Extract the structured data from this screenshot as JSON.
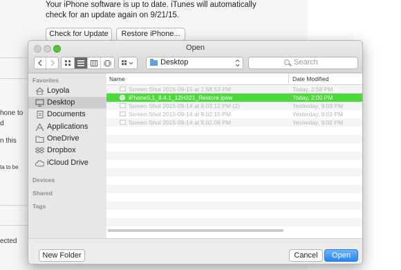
{
  "background": {
    "status_line1": "Your iPhone software is up to date. iTunes will automatically",
    "status_line2": "check for an update again on 9/21/15.",
    "check_update_label": "Check for Update",
    "restore_label": "Restore iPhone...",
    "side_text": [
      "hone to",
      "d",
      "n this",
      "ta to be",
      "ected"
    ]
  },
  "dialog": {
    "title": "Open",
    "location": "Desktop",
    "search_placeholder": "Search",
    "sidebar": {
      "favorites_header": "Favorites",
      "devices_header": "Devices",
      "shared_header": "Shared",
      "tags_header": "Tags",
      "items": [
        {
          "label": "Loyola",
          "icon": "home-icon"
        },
        {
          "label": "Desktop",
          "icon": "desktop-icon"
        },
        {
          "label": "Documents",
          "icon": "documents-icon"
        },
        {
          "label": "Applications",
          "icon": "applications-icon"
        },
        {
          "label": "OneDrive",
          "icon": "folder-icon"
        },
        {
          "label": "Dropbox",
          "icon": "dropbox-icon"
        },
        {
          "label": "iCloud Drive",
          "icon": "cloud-icon"
        }
      ]
    },
    "columns": {
      "name": "Name",
      "date": "Date Modified"
    },
    "files": [
      {
        "name": "Screen Shot 2015-09-15 at 2.58.53 PM",
        "date": "Today, 2:58 PM"
      },
      {
        "name": "iPhone5,1_8.4.1_12H321_Restore.ipsw",
        "date": "Today, 2:00 PM"
      },
      {
        "name": "Screen Shot 2015-09-14 at 9.03.12 PM (2)",
        "date": "Yesterday, 9:03 PM"
      },
      {
        "name": "Screen Shot 2015-09-14 at 9.02.15 PM",
        "date": "Yesterday, 9:02 PM"
      },
      {
        "name": "Screen Shot 2015-09-14 at 9.02.06 PM",
        "date": "Yesterday, 9:02 PM"
      }
    ],
    "new_folder_label": "New Folder",
    "cancel_label": "Cancel",
    "open_label": "Open"
  }
}
